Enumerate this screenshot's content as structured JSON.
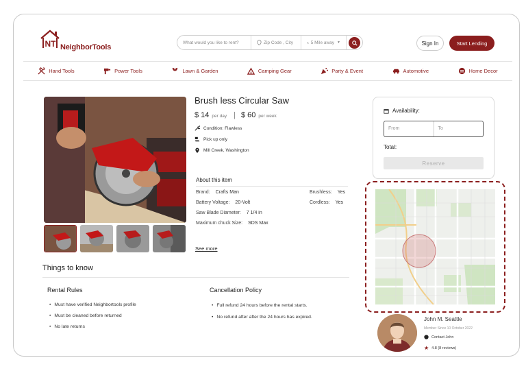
{
  "brand": {
    "name": "NeighborTools",
    "mark": "NT",
    "color": "#8b1e1e"
  },
  "search": {
    "what_placeholder": "What would you like to rent?",
    "where_placeholder": "Zip Code , City",
    "distance": "5 Mile away"
  },
  "header": {
    "sign_in": "Sign In",
    "start_lending": "Start Lending"
  },
  "nav": [
    {
      "label": "Hand Tools",
      "icon": "hand-tools-icon"
    },
    {
      "label": "Power Tools",
      "icon": "power-tools-icon"
    },
    {
      "label": "Lawn & Garden",
      "icon": "lawn-garden-icon"
    },
    {
      "label": "Camping Gear",
      "icon": "camping-icon"
    },
    {
      "label": "Party & Event",
      "icon": "party-icon"
    },
    {
      "label": "Automotive",
      "icon": "car-icon"
    },
    {
      "label": "Home Decor",
      "icon": "home-decor-icon"
    }
  ],
  "product": {
    "title": "Brush less Circular Saw",
    "price_day": "$ 14",
    "price_day_unit": "per day",
    "price_week": "$ 60",
    "price_week_unit": "per week",
    "condition": "Condition: Flawless",
    "pickup": "Pick up only",
    "location": "Mill Creek, Washington",
    "about_title": "About this item",
    "specs": {
      "brand_label": "Brand:",
      "brand": "Crafts Man",
      "voltage_label": "Battery Voltage:",
      "voltage": "20-Volt",
      "blade_label": "Saw Blade Diameter:",
      "blade": "7 1/4 in",
      "chuck_label": "Maximum chuck Size:",
      "chuck": "SDS Max",
      "brushless_label": "Brushless:",
      "brushless": "Yes",
      "cordless_label": "Cordless:",
      "cordless": "Yes"
    },
    "see_more": "See more"
  },
  "things": {
    "title": "Things to know",
    "rental_rules": {
      "title": "Rental Rules",
      "items": [
        "Must have verified Neighbortools profile",
        "Must be cleaned before returned",
        "No late returns"
      ]
    },
    "cancellation": {
      "title": "Cancellation Policy",
      "items": [
        "Full refund 24 hours before the rental starts.",
        "No refund after after the 24 hours has expired."
      ]
    }
  },
  "booking": {
    "availability": "Availability:",
    "from_placeholder": "From",
    "to_placeholder": "To",
    "total": "Total:",
    "reserve": "Reserve"
  },
  "owner": {
    "name": "John M. Seattle",
    "since": "Member Since 10 October 2022",
    "contact": "Contact John",
    "rating": "4.8 (8 reviews)"
  }
}
